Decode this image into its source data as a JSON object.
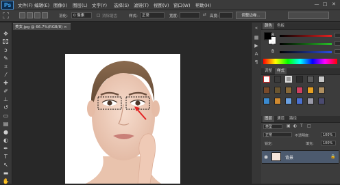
{
  "app": {
    "logo": "Ps"
  },
  "menu": [
    "文件(F)",
    "编辑(E)",
    "图像(I)",
    "图层(L)",
    "文字(Y)",
    "选择(S)",
    "滤镜(T)",
    "视图(V)",
    "窗口(W)",
    "帮助(H)"
  ],
  "window_controls": {
    "minimize": "—",
    "restore": "□",
    "close": "✕"
  },
  "options": {
    "feather_label": "羽化:",
    "feather_value": "0 像素",
    "antialias_label": "消除锯齿",
    "style_label": "样式:",
    "style_value": "正常",
    "width_label": "宽度:",
    "height_label": "高度:",
    "refine_label": "调整边缘..."
  },
  "document": {
    "tab_title": "美女.jpg @ 66.7%(RGB/8) ×"
  },
  "color_panel": {
    "tabs": [
      "颜色",
      "色板"
    ],
    "channels": [
      {
        "label": "R",
        "value": "0",
        "color": "#e23030"
      },
      {
        "label": "G",
        "value": "0",
        "color": "#30c030"
      },
      {
        "label": "B",
        "value": "0",
        "color": "#3050e0"
      }
    ]
  },
  "adjust_panel": {
    "tabs": [
      "调整",
      "样式"
    ]
  },
  "layers_panel": {
    "tabs": [
      "图层",
      "通道",
      "路径"
    ],
    "kind_label": "类型",
    "blend_mode": "正常",
    "opacity_label": "不透明度:",
    "opacity_value": "100%",
    "lock_label": "锁定:",
    "fill_label": "填充:",
    "fill_value": "100%",
    "layer_name": "背景"
  }
}
